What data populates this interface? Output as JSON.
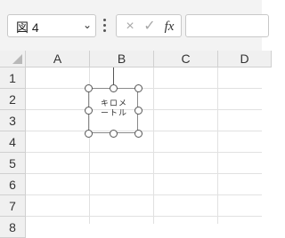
{
  "formula_bar": {
    "name_box_value": "図 4",
    "name_box_dropdown_icon": "chevron-down-icon",
    "more_icon": "vertical-dots-icon",
    "cancel_icon": "×",
    "enter_icon": "✓",
    "fx_label": "fx",
    "formula_value": ""
  },
  "columns": [
    "A",
    "B",
    "C",
    "D"
  ],
  "rows": [
    "1",
    "2",
    "3",
    "4",
    "5",
    "6",
    "7",
    "8"
  ],
  "shape": {
    "text_line1": "キロメ",
    "text_line2": "ートル"
  }
}
